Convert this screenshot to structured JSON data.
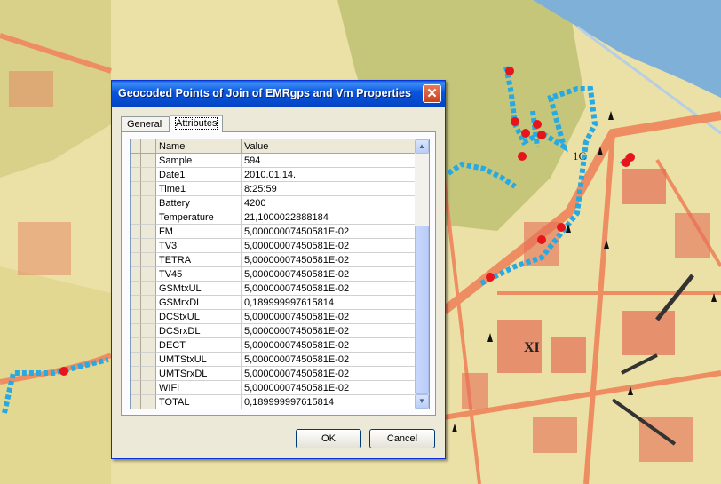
{
  "dialog": {
    "title": "Geocoded Points of Join of EMRgps and Vm Properties",
    "close_glyph": "✕",
    "tabs": [
      {
        "label": "General",
        "selected": false
      },
      {
        "label": "Attributes",
        "selected": true
      }
    ],
    "table": {
      "headers": [
        "Name",
        "Value"
      ],
      "rows": [
        {
          "name": "Sample",
          "value": "594"
        },
        {
          "name": "Date1",
          "value": "2010.01.14."
        },
        {
          "name": "Time1",
          "value": "8:25:59"
        },
        {
          "name": "Battery",
          "value": "4200"
        },
        {
          "name": "Temperature",
          "value": "21,1000022888184"
        },
        {
          "name": "FM",
          "value": "5,00000007450581E-02"
        },
        {
          "name": "TV3",
          "value": "5,00000007450581E-02"
        },
        {
          "name": "TETRA",
          "value": "5,00000007450581E-02"
        },
        {
          "name": "TV45",
          "value": "5,00000007450581E-02"
        },
        {
          "name": "GSMtxUL",
          "value": "5,00000007450581E-02"
        },
        {
          "name": "GSMrxDL",
          "value": "0,189999997615814"
        },
        {
          "name": "DCStxUL",
          "value": "5,00000007450581E-02"
        },
        {
          "name": "DCSrxDL",
          "value": "5,00000007450581E-02"
        },
        {
          "name": "DECT",
          "value": "5,00000007450581E-02"
        },
        {
          "name": "UMTStxUL",
          "value": "5,00000007450581E-02"
        },
        {
          "name": "UMTSrxDL",
          "value": "5,00000007450581E-02"
        },
        {
          "name": "WIFI",
          "value": "5,00000007450581E-02"
        },
        {
          "name": "TOTAL",
          "value": "0,189999997615814"
        }
      ]
    },
    "buttons": {
      "ok": "OK",
      "cancel": "Cancel"
    }
  },
  "map": {
    "labels": [
      "XI",
      "1C"
    ],
    "colors": {
      "background": "#e9dfa0",
      "road": "#ee8a60",
      "river": "#7fb0d8",
      "green": "#c9c877",
      "track": "#27a9e1",
      "marker": "#e8141b"
    }
  }
}
